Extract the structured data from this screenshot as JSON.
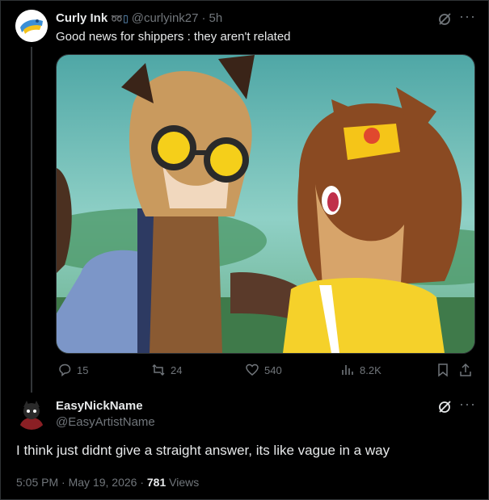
{
  "tweet": {
    "display_name": "Curly Ink",
    "badge": "➿▯",
    "handle": "@curlyink27",
    "separator": "·",
    "time": "5h",
    "text": "Good news for shippers : they aren't related",
    "actions": {
      "replies": "15",
      "reposts": "24",
      "likes": "540",
      "views": "8.2K"
    },
    "icons": [
      "grok-icon",
      "more-icon",
      "reply-icon",
      "repost-icon",
      "like-icon",
      "views-icon",
      "bookmark-icon",
      "share-icon"
    ],
    "media": {
      "alt_colors": {
        "sky": "#5fb3ad",
        "hair_left": "#c79a5d",
        "hair_right": "#8a4a22",
        "goggles": "#f5cf1a",
        "top": "#f5d12a"
      }
    }
  },
  "reply": {
    "display_name": "EasyNickName",
    "handle": "@EasyArtistName",
    "text": "I think just didnt give a straight answer, its like vague in a way",
    "time": "5:05 PM",
    "date": "May 19, 2026",
    "views_count": "781",
    "views_label": "Views",
    "separator": "·"
  },
  "colors": {
    "background": "#000000",
    "text": "#e7e9ea",
    "muted": "#71767b",
    "border": "#2f3336",
    "accent": "#1d9bf0"
  }
}
